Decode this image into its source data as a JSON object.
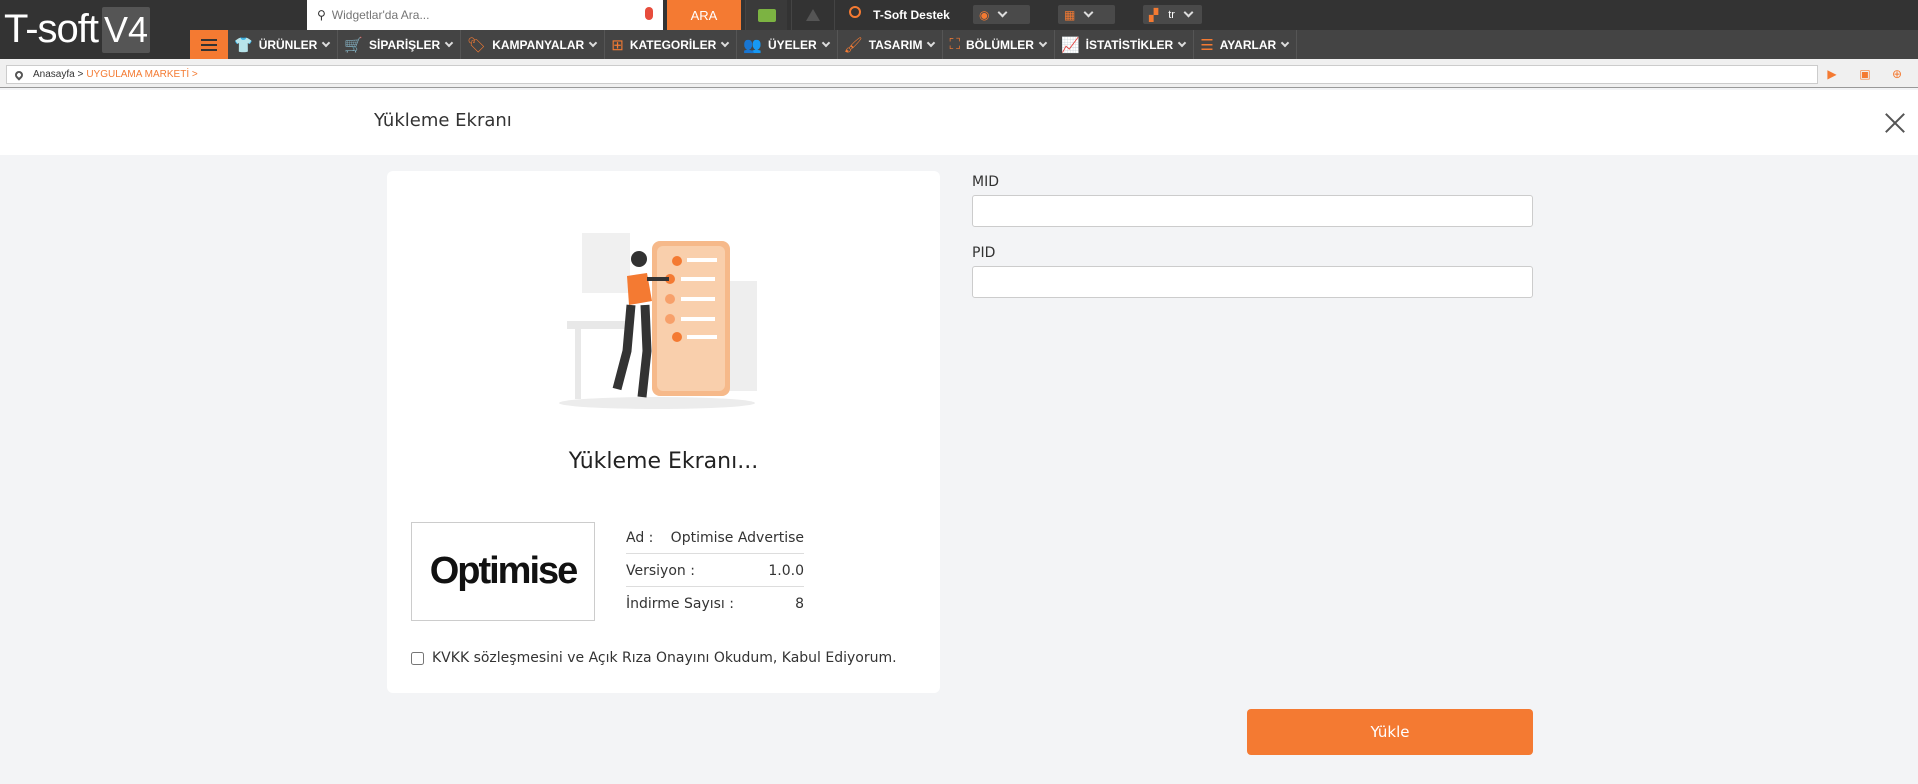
{
  "logo": {
    "text": "T-soft",
    "version": "V4"
  },
  "topbar": {
    "search_placeholder": "Widgetlar'da Ara...",
    "search_button": "ARA",
    "support_label": "T-Soft Destek",
    "language": "tr"
  },
  "nav": {
    "items": [
      {
        "label": "ÜRÜNLER",
        "icon": "shirt-icon",
        "glyph": "👕"
      },
      {
        "label": "SİPARİŞLER",
        "icon": "cart-icon",
        "glyph": "🛒"
      },
      {
        "label": "KAMPANYALAR",
        "icon": "tag-icon",
        "glyph": "🏷"
      },
      {
        "label": "KATEGORİLER",
        "icon": "sitemap-icon",
        "glyph": "⊞"
      },
      {
        "label": "ÜYELER",
        "icon": "users-icon",
        "glyph": "👥"
      },
      {
        "label": "TASARIM",
        "icon": "brush-icon",
        "glyph": "🖌"
      },
      {
        "label": "BÖLÜMLER",
        "icon": "hierarchy-icon",
        "glyph": "⛶"
      },
      {
        "label": "İSTATİSTİKLER",
        "icon": "chart-icon",
        "glyph": "📈"
      },
      {
        "label": "AYARLAR",
        "icon": "settings-list-icon",
        "glyph": "☰"
      }
    ]
  },
  "breadcrumb": {
    "home": "Anasayfa >",
    "current": "UYGULAMA MARKETİ >"
  },
  "modal": {
    "title": "Yükleme Ekranı",
    "card_subtitle": "Yükleme Ekranı...",
    "brand": "Optimise",
    "info": {
      "name_label": "Ad :",
      "name_value": "Optimise Advertise",
      "version_label": "Versiyon :",
      "version_value": "1.0.0",
      "downloads_label": "İndirme Sayısı :",
      "downloads_value": "8"
    },
    "consent_text": "KVKK sözleşmesini ve Açık Rıza Onayını Okudum, Kabul Ediyorum.",
    "fields": {
      "mid_label": "MID",
      "pid_label": "PID"
    },
    "submit_label": "Yükle"
  },
  "colors": {
    "accent": "#f47a32",
    "dark": "#333333"
  }
}
